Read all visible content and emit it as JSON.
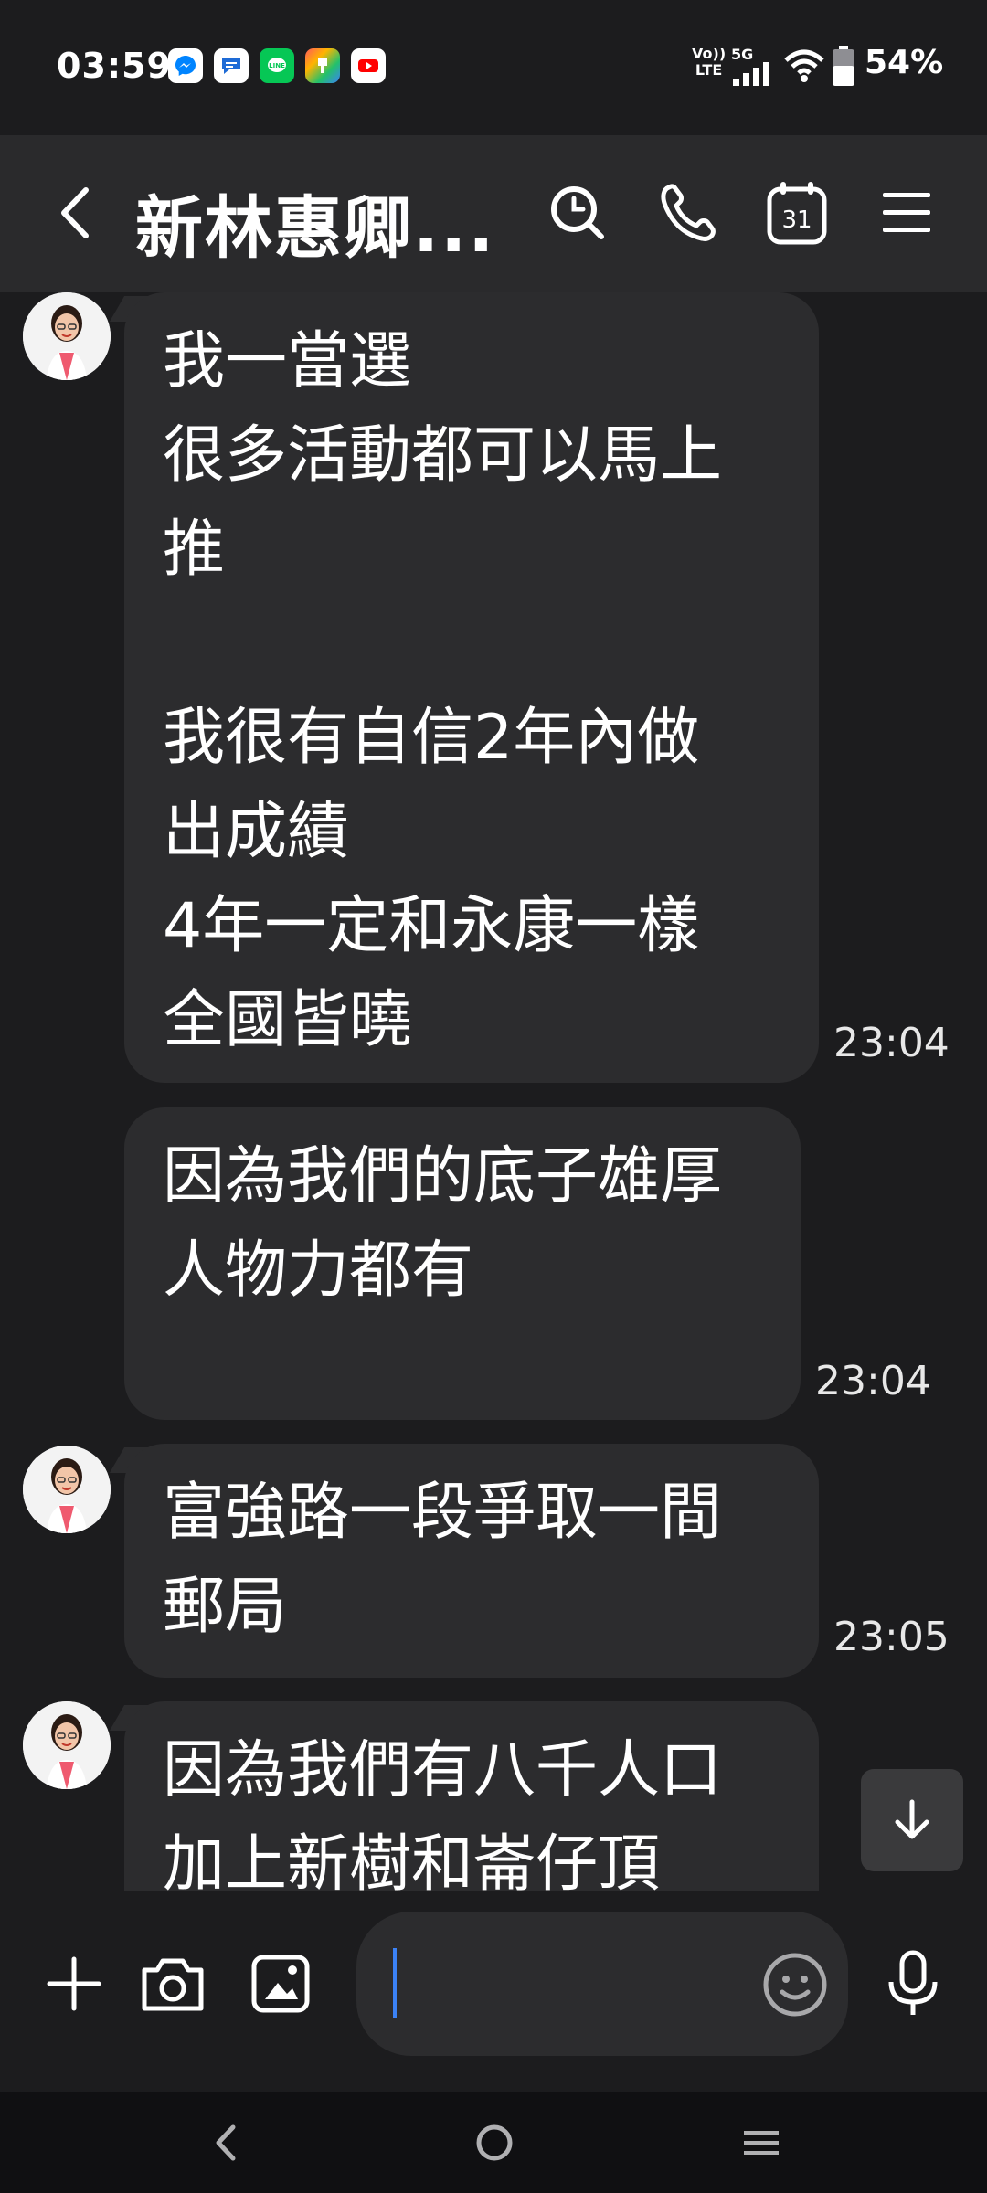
{
  "status_bar": {
    "time": "03:59",
    "notification_icons": [
      "messenger-icon",
      "messages-icon",
      "line-icon",
      "gallery-icon",
      "youtube-icon"
    ],
    "volte_label": "Vo)) LTE",
    "network": "5G",
    "battery": "54%"
  },
  "header": {
    "title": "新林惠卿...",
    "icons": [
      "back-icon",
      "search-icon",
      "phone-icon",
      "calendar-icon",
      "menu-icon"
    ],
    "calendar_day": "31"
  },
  "messages": [
    {
      "text": "我一當選\n很多活動都可以馬上\n推\n\n我很有自信2年內做\n出成績\n4年一定和永康一樣\n全國皆曉",
      "time": "23:04",
      "show_avatar": true
    },
    {
      "text": "因為我們的底子雄厚\n人物力都有\n",
      "time": "23:04",
      "show_avatar": false
    },
    {
      "text": "富強路一段爭取一間\n郵局",
      "time": "23:05",
      "show_avatar": true
    },
    {
      "text": "因為我們有八千人口\n加上新樹和崙仔頂",
      "time": "",
      "show_avatar": true
    }
  ],
  "input_bar": {
    "icons": [
      "plus-icon",
      "camera-icon",
      "image-icon",
      "emoji-icon",
      "microphone-icon"
    ],
    "input_value": ""
  },
  "colors": {
    "background": "#1c1c1e",
    "header": "#2a2a2c",
    "bubble": "#2c2c2e",
    "caret": "#3b82f6",
    "messenger": "#0084ff",
    "line": "#06c755",
    "youtube": "#ff0000"
  }
}
